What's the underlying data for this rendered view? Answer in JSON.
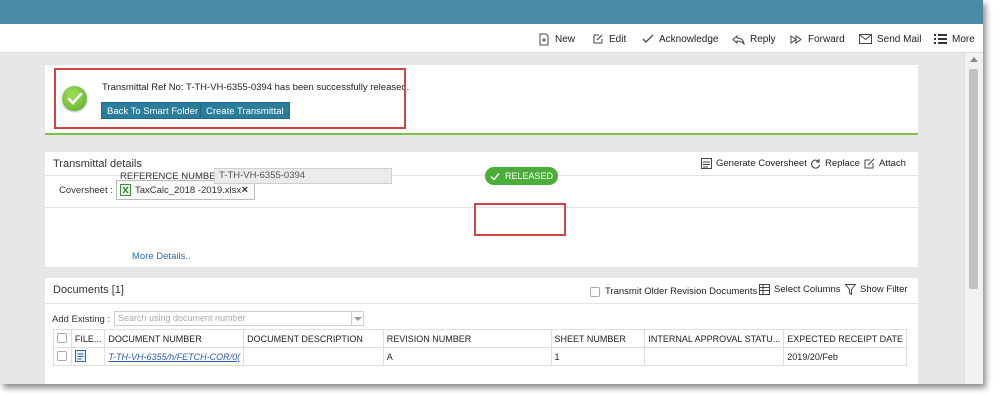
{
  "toolbar": {
    "items": [
      {
        "label": "New",
        "icon": "new-document-icon"
      },
      {
        "label": "Edit",
        "icon": "edit-icon"
      },
      {
        "label": "Acknowledge",
        "icon": "checkmark-icon"
      },
      {
        "label": "Reply",
        "icon": "reply-icon"
      },
      {
        "label": "Forward",
        "icon": "forward-icon"
      },
      {
        "label": "Send Mail",
        "icon": "mail-icon"
      },
      {
        "label": "More",
        "icon": "list-icon"
      }
    ]
  },
  "success": {
    "message": "Transmittal Ref No: T-TH-VH-6355-0394 has been successfully released.",
    "back_button": "Back To Smart Folder",
    "create_button": "Create Transmittal"
  },
  "details": {
    "title": "Transmittal details",
    "actions": {
      "generate": "Generate Coversheet",
      "replace": "Replace",
      "attach": "Attach"
    },
    "coversheet_label": "Coversheet :",
    "coversheet_file": "TaxCalc_2018 -2019.xlsx",
    "remove_glyph": "×",
    "reference_label": "REFERENCE NUMBER:*",
    "reference_value": "T-TH-VH-6355-0394",
    "status": "RELEASED",
    "more_details": "More Details.."
  },
  "documents": {
    "title": "Documents [1]",
    "transmit_older": "Transmit Older Revision Documents",
    "select_columns": "Select Columns",
    "show_filter": "Show Filter",
    "add_existing_label": "Add Existing :",
    "search_placeholder": "Search using document number",
    "columns": [
      "FILE...",
      "DOCUMENT NUMBER",
      "DOCUMENT DESCRIPTION",
      "REVISION NUMBER",
      "SHEET NUMBER",
      "INTERNAL APPROVAL STATU...",
      "EXPECTED RECEIPT DATE"
    ],
    "rows": [
      {
        "document_number": "T-TH-VH-6355/h/FETCH-COR/0(",
        "description": "",
        "revision": "A",
        "sheet": "1",
        "internal_approval": "",
        "expected_receipt": "2019/20/Feb"
      }
    ]
  },
  "colors": {
    "topbar": "#4a8ca8",
    "button": "#2b7d9c",
    "released": "#4cae3a",
    "success_rule": "#7cc242",
    "highlight": "#d04545",
    "link": "#2b6fb0"
  }
}
